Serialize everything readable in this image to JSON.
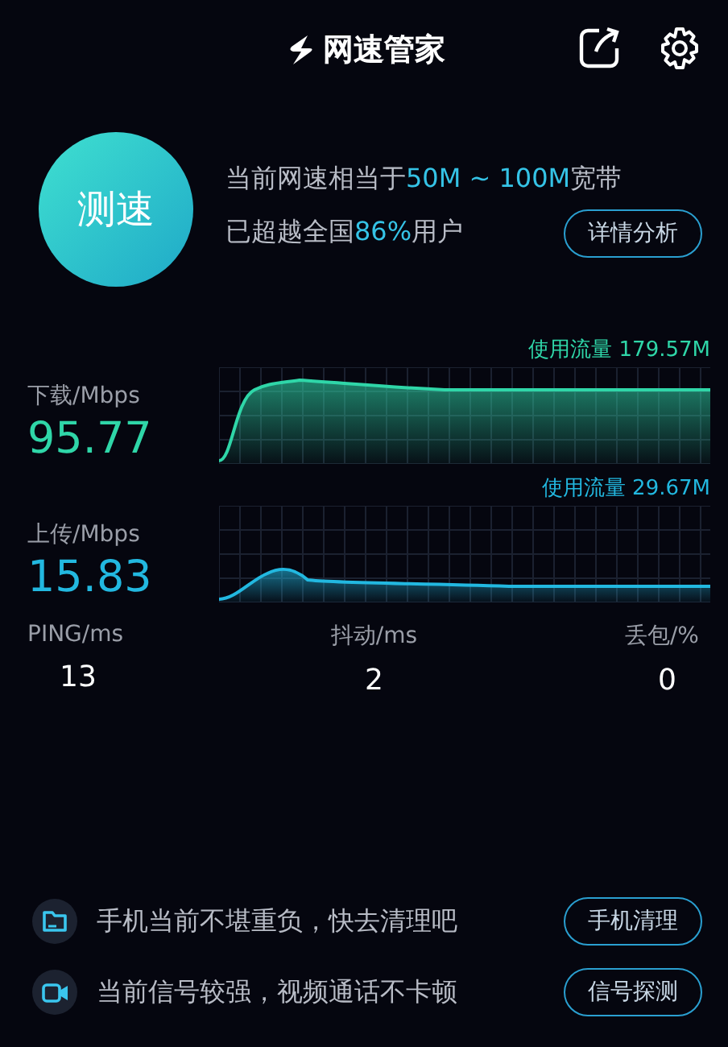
{
  "app": {
    "title": "网速管家"
  },
  "speed_test_button": "测速",
  "summary": {
    "lines": [
      "当前网速相当于**50M ~ 100M**宽带",
      "已超越全国**86%**用户"
    ],
    "detail_button": "详情分析"
  },
  "metrics": [
    {
      "kind": "download",
      "label": "下载/Mbps",
      "value": "95.77",
      "usage": "使用流量 179.57M"
    },
    {
      "kind": "upload",
      "label": "上传/Mbps",
      "value": "15.83",
      "usage": "使用流量 29.67M"
    }
  ],
  "stats": [
    {
      "label": "PING/ms",
      "value": "13"
    },
    {
      "label": "抖动/ms",
      "value": "2"
    },
    {
      "label": "丢包/%",
      "value": "0"
    }
  ],
  "tips": [
    {
      "kind": "folder",
      "text": "手机当前不堪重负，快去清理吧",
      "button": "手机清理"
    },
    {
      "kind": "video",
      "text": "当前信号较强，视频通话不卡顿",
      "button": "信号探测"
    }
  ]
}
